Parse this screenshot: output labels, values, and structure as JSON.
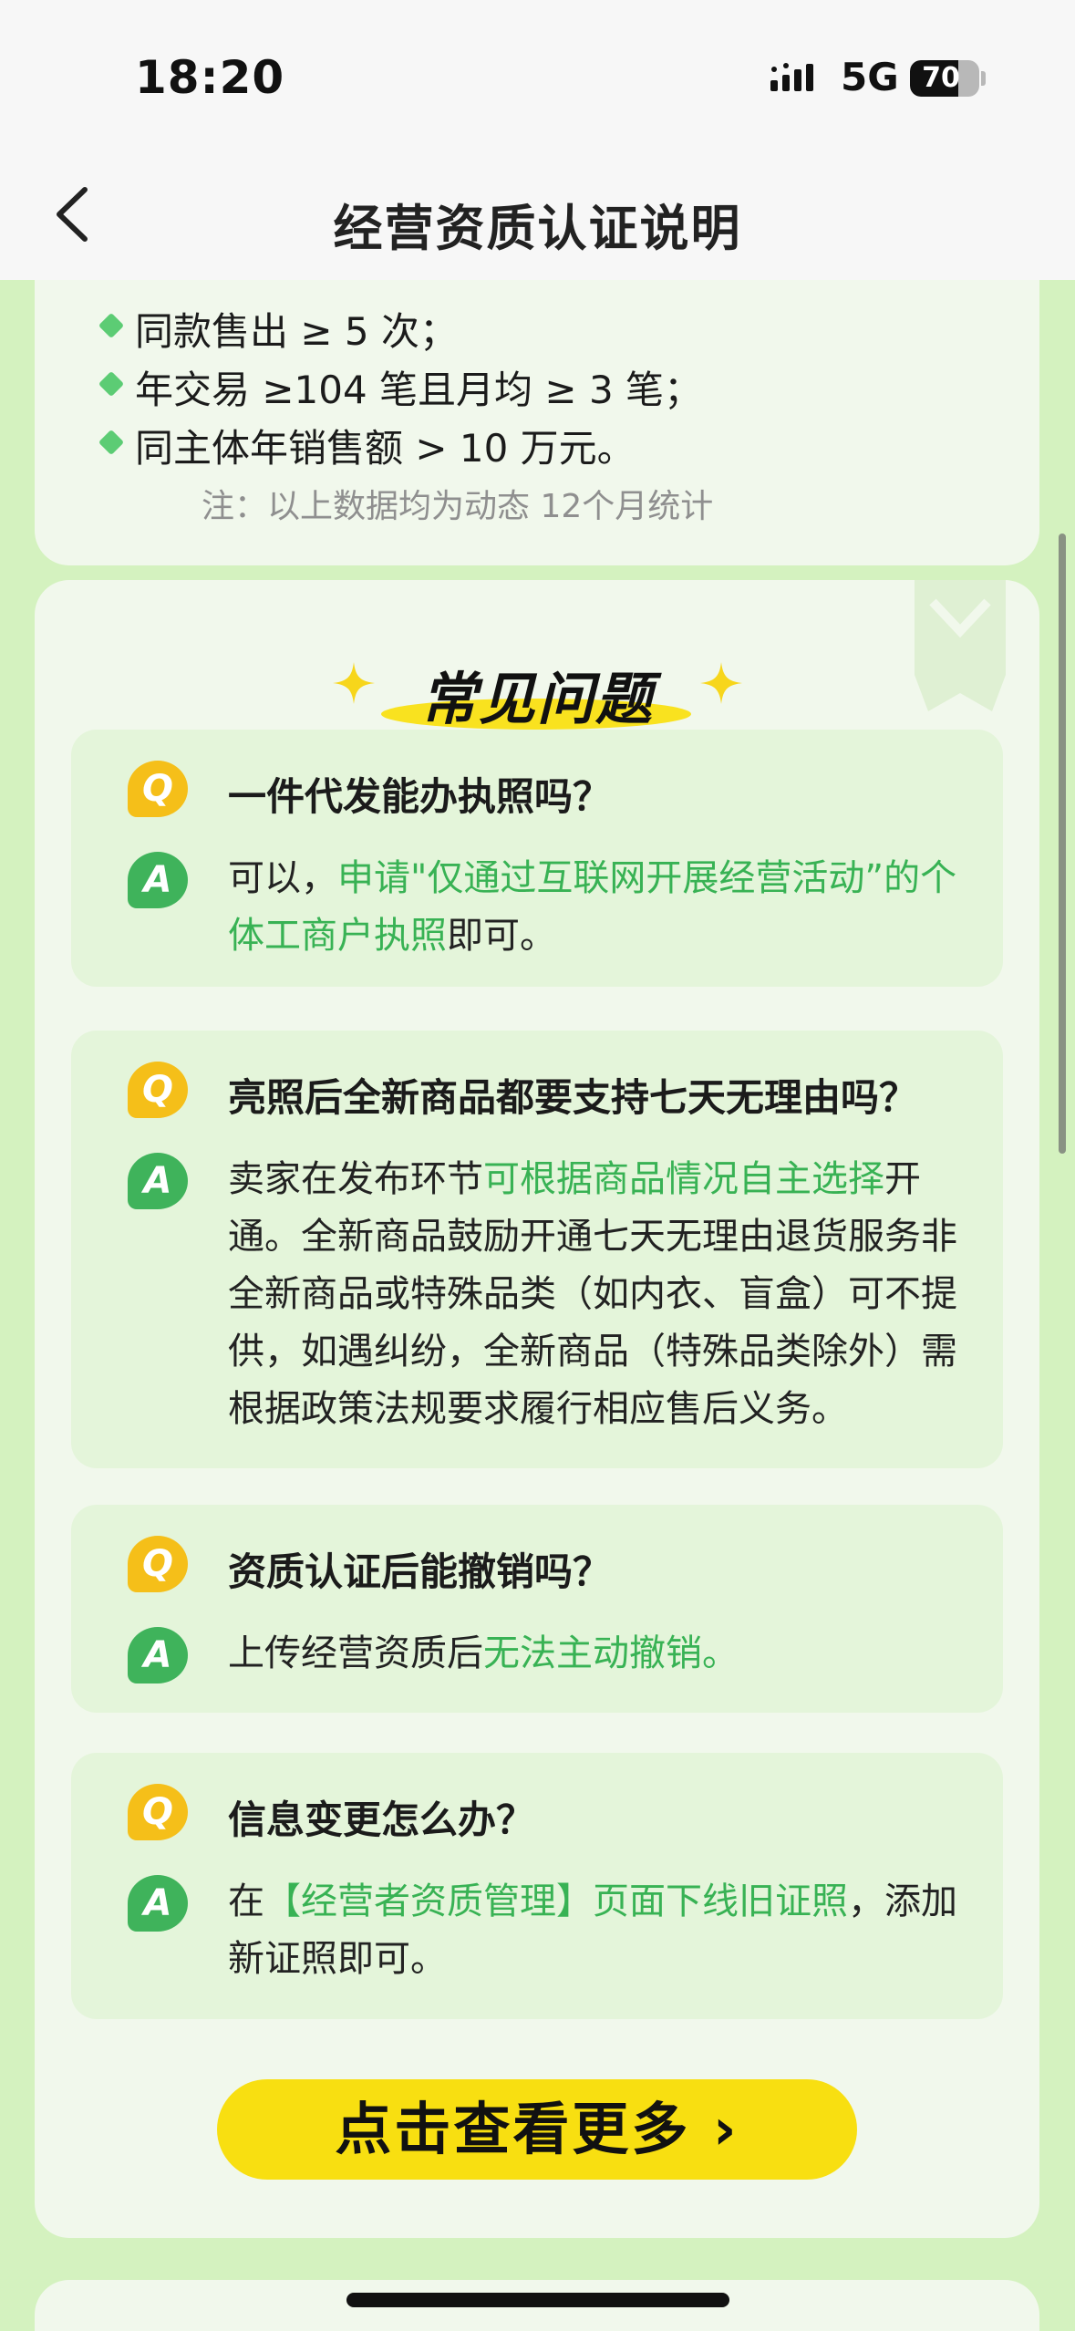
{
  "status": {
    "time": "18:20",
    "network": "5G",
    "battery": "70",
    "battery_level": 0.7
  },
  "nav": {
    "title": "经营资质认证说明",
    "back_icon": "chevron-left-icon"
  },
  "requirements": {
    "items": [
      "同款售出 ≥ 5 次；",
      "年交易 ≥104 笔且月均 ≥ 3 笔；",
      "同主体年销售额 > 10 万元。"
    ],
    "note": "注：以上数据均为动态 12个月统计"
  },
  "faq": {
    "heading": "常见问题",
    "q_letter": "Q",
    "a_letter": "A",
    "items": [
      {
        "question": "一件代发能办执照吗？",
        "answer": [
          {
            "text": "可以，",
            "green": false
          },
          {
            "text": "申请\"仅通过互联网开展经营活动”的个体工商户执照",
            "green": true
          },
          {
            "text": "即可。",
            "green": false
          }
        ]
      },
      {
        "question": "亮照后全新商品都要支持七天无理由吗？",
        "answer": [
          {
            "text": "卖家在发布环节",
            "green": false
          },
          {
            "text": "可根据商品情况自主选择",
            "green": true
          },
          {
            "text": "开通。全新商品鼓励开通七天无理由退货服务非全新商品或特殊品类（如内衣、盲盒）可不提供，如遇纠纷，全新商品（特殊品类除外）需根据政策法规要求履行相应售后义务。",
            "green": false
          }
        ]
      },
      {
        "question": "资质认证后能撤销吗？",
        "answer": [
          {
            "text": "上传经营资质后",
            "green": false
          },
          {
            "text": "无法主动撤销。",
            "green": true
          }
        ]
      },
      {
        "question": "信息变更怎么办？",
        "answer": [
          {
            "text": "在",
            "green": false
          },
          {
            "text": "【经营者资质管理】页面下线旧证照",
            "green": true
          },
          {
            "text": "，添加新证照即可。",
            "green": false
          }
        ]
      }
    ],
    "more_button": "点击查看更多"
  },
  "colors": {
    "background": "#d4f2bf",
    "card": "#f1f8ec",
    "qa_card": "#e4f5da",
    "accent_green": "#38b254",
    "q_icon": "#f5bf19",
    "a_icon": "#3fb35b",
    "button_yellow": "#f8df11"
  }
}
